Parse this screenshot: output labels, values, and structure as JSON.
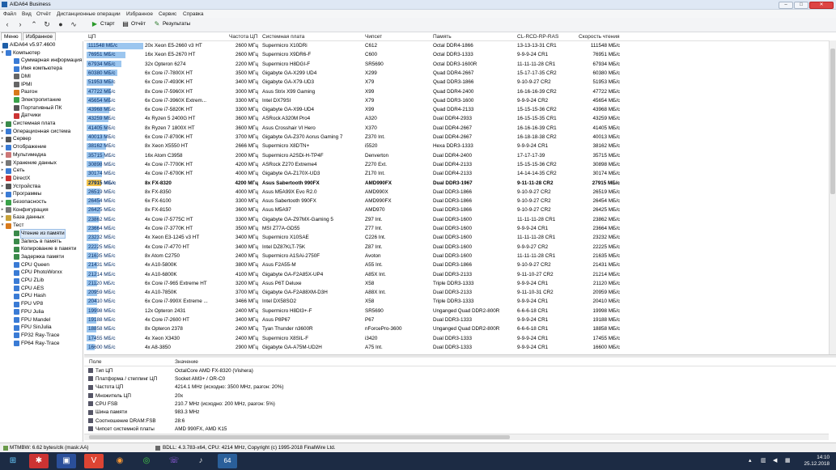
{
  "window": {
    "title": "AIDA64 Business"
  },
  "menu": [
    "Файл",
    "Вид",
    "Отчёт",
    "Дистанционные операции",
    "Избранное",
    "Сервис",
    "Справка"
  ],
  "toolbar": {
    "start": "Старт",
    "report": "Отчёт",
    "results": "Результаты"
  },
  "tabs": {
    "menu": "Меню",
    "favorites": "Избранное"
  },
  "tree": [
    {
      "label": "AIDA64 v5.97.4600",
      "level": 0,
      "exp": "",
      "color": "#1f5fa8"
    },
    {
      "label": "Компьютер",
      "level": 1,
      "exp": "▾",
      "color": "#3a7bd5"
    },
    {
      "label": "Суммарная информация",
      "level": 2,
      "exp": "",
      "color": "#3a7bd5"
    },
    {
      "label": "Имя компьютера",
      "level": 2,
      "exp": "",
      "color": "#3a7bd5"
    },
    {
      "label": "DMI",
      "level": 2,
      "exp": "",
      "color": "#666"
    },
    {
      "label": "IPMI",
      "level": 2,
      "exp": "",
      "color": "#666"
    },
    {
      "label": "Разгон",
      "level": 2,
      "exp": "",
      "color": "#d87a1c"
    },
    {
      "label": "Электропитание",
      "level": 2,
      "exp": "",
      "color": "#3aa24a"
    },
    {
      "label": "Портативный ПК",
      "level": 2,
      "exp": "",
      "color": "#555"
    },
    {
      "label": "Датчики",
      "level": 2,
      "exp": "",
      "color": "#c33"
    },
    {
      "label": "Системная плата",
      "level": 1,
      "exp": "▸",
      "color": "#3a8a4a"
    },
    {
      "label": "Операционная система",
      "level": 1,
      "exp": "▸",
      "color": "#3a7bd5"
    },
    {
      "label": "Сервер",
      "level": 1,
      "exp": "▸",
      "color": "#555"
    },
    {
      "label": "Отображение",
      "level": 1,
      "exp": "▸",
      "color": "#3a7bd5"
    },
    {
      "label": "Мультимедиа",
      "level": 1,
      "exp": "▸",
      "color": "#c77"
    },
    {
      "label": "Хранение данных",
      "level": 1,
      "exp": "▸",
      "color": "#777"
    },
    {
      "label": "Сеть",
      "level": 1,
      "exp": "▸",
      "color": "#3a7bd5"
    },
    {
      "label": "DirectX",
      "level": 1,
      "exp": "▸",
      "color": "#c33"
    },
    {
      "label": "Устройства",
      "level": 1,
      "exp": "▸",
      "color": "#555"
    },
    {
      "label": "Программы",
      "level": 1,
      "exp": "▸",
      "color": "#3a7bd5"
    },
    {
      "label": "Безопасность",
      "level": 1,
      "exp": "▸",
      "color": "#3aa24a"
    },
    {
      "label": "Конфигурация",
      "level": 1,
      "exp": "▸",
      "color": "#777"
    },
    {
      "label": "База данных",
      "level": 1,
      "exp": "▸",
      "color": "#c8a23a"
    },
    {
      "label": "Тест",
      "level": 1,
      "exp": "▾",
      "color": "#d87a1c"
    },
    {
      "label": "Чтение из памяти",
      "level": 2,
      "exp": "",
      "color": "#3a8a4a",
      "selected": true
    },
    {
      "label": "Запись в память",
      "level": 2,
      "exp": "",
      "color": "#3a8a4a"
    },
    {
      "label": "Копирование в памяти",
      "level": 2,
      "exp": "",
      "color": "#3a8a4a"
    },
    {
      "label": "Задержка памяти",
      "level": 2,
      "exp": "",
      "color": "#3a8a4a"
    },
    {
      "label": "CPU Queen",
      "level": 2,
      "exp": "",
      "color": "#3a7bd5"
    },
    {
      "label": "CPU PhotoWorxx",
      "level": 2,
      "exp": "",
      "color": "#3a7bd5"
    },
    {
      "label": "CPU ZLib",
      "level": 2,
      "exp": "",
      "color": "#3a7bd5"
    },
    {
      "label": "CPU AES",
      "level": 2,
      "exp": "",
      "color": "#3a7bd5"
    },
    {
      "label": "CPU Hash",
      "level": 2,
      "exp": "",
      "color": "#3a7bd5"
    },
    {
      "label": "FPU VP8",
      "level": 2,
      "exp": "",
      "color": "#3a7bd5"
    },
    {
      "label": "FPU Julia",
      "level": 2,
      "exp": "",
      "color": "#3a7bd5"
    },
    {
      "label": "FPU Mandel",
      "level": 2,
      "exp": "",
      "color": "#3a7bd5"
    },
    {
      "label": "FPU SinJulia",
      "level": 2,
      "exp": "",
      "color": "#3a7bd5"
    },
    {
      "label": "FP32 Ray-Trace",
      "level": 2,
      "exp": "",
      "color": "#3a7bd5"
    },
    {
      "label": "FP64 Ray-Trace",
      "level": 2,
      "exp": "",
      "color": "#3a7bd5"
    }
  ],
  "columns": [
    "ЦП",
    "Частота ЦП",
    "Системная плата",
    "Чипсет",
    "Память",
    "CL-RCD-RP-RAS",
    "Скорость чтения"
  ],
  "bar_max": 111548,
  "rows": [
    {
      "score": 111548,
      "speed": "111548 МБ/с",
      "cpu": "20x Xeon E5-2660 v3 HT",
      "freq": "2600 МГц",
      "board": "Supermicro X10DRi",
      "chipset": "C612",
      "mem": "Octal DDR4-1866",
      "timing": "13-13-13-31 CR1",
      "read": "111548 МБ/с"
    },
    {
      "score": 76951,
      "speed": "76951 МБ/с",
      "cpu": "16x Xeon E5-2670 HT",
      "freq": "2600 МГц",
      "board": "Supermicro X9DR6-F",
      "chipset": "C600",
      "mem": "Octal DDR3-1333",
      "timing": "9-9-9-24 CR1",
      "read": "76951 МБ/с"
    },
    {
      "score": 67934,
      "speed": "67934 МБ/с",
      "cpu": "32x Opteron 6274",
      "freq": "2200 МГц",
      "board": "Supermicro H8DGI-F",
      "chipset": "SR5690",
      "mem": "Octal DDR3-1600R",
      "timing": "11-11-11-28 CR1",
      "read": "67934 МБ/с"
    },
    {
      "score": 60380,
      "speed": "60380 МБ/с",
      "cpu": "6x Core i7-7800X HT",
      "freq": "3500 МГц",
      "board": "Gigabyte GA-X299 UD4",
      "chipset": "X299",
      "mem": "Quad DDR4-2667",
      "timing": "15-17-17-35 CR2",
      "read": "60380 МБ/с"
    },
    {
      "score": 51953,
      "speed": "51953 МБ/с",
      "cpu": "6x Core i7-4930K HT",
      "freq": "3400 МГц",
      "board": "Gigabyte GA-X79-UD3",
      "chipset": "X79",
      "mem": "Quad DDR3-1866",
      "timing": "9-10-9-27 CR2",
      "read": "51953 МБ/с"
    },
    {
      "score": 47722,
      "speed": "47722 МБ/с",
      "cpu": "8x Core i7-5960X HT",
      "freq": "3000 МГц",
      "board": "Asus Strix X99 Gaming",
      "chipset": "X99",
      "mem": "Quad DDR4-2400",
      "timing": "16-16-16-39 CR2",
      "read": "47722 МБ/с"
    },
    {
      "score": 45654,
      "speed": "45654 МБ/с",
      "cpu": "6x Core i7-3960X Extrem...",
      "freq": "3300 МГц",
      "board": "Intel DX79SI",
      "chipset": "X79",
      "mem": "Quad DDR3-1600",
      "timing": "9-9-9-24 CR2",
      "read": "45654 МБ/с"
    },
    {
      "score": 43968,
      "speed": "43968 МБ/с",
      "cpu": "6x Core i7-5820K HT",
      "freq": "3300 МГц",
      "board": "Gigabyte GA-X99-UD4",
      "chipset": "X99",
      "mem": "Quad DDR4-2133",
      "timing": "15-15-15-36 CR2",
      "read": "43968 МБ/с"
    },
    {
      "score": 43259,
      "speed": "43259 МБ/с",
      "cpu": "4x Ryzen 5 2400G HT",
      "freq": "3600 МГц",
      "board": "ASRock A320M Pro4",
      "chipset": "A320",
      "mem": "Dual DDR4-2933",
      "timing": "16-15-15-35 CR1",
      "read": "43259 МБ/с"
    },
    {
      "score": 41405,
      "speed": "41405 МБ/с",
      "cpu": "8x Ryzen 7 1800X HT",
      "freq": "3600 МГц",
      "board": "Asus Crosshair VI Hero",
      "chipset": "X370",
      "mem": "Dual DDR4-2667",
      "timing": "16-16-16-39 CR1",
      "read": "41405 МБ/с"
    },
    {
      "score": 40013,
      "speed": "40013 МБ/с",
      "cpu": "6x Core i7-8700K HT",
      "freq": "3700 МГц",
      "board": "Gigabyte GA-Z370 Aorus Gaming 7",
      "chipset": "Z370 Int.",
      "mem": "Dual DDR4-2667",
      "timing": "16-18-18-38 CR2",
      "read": "40013 МБ/с"
    },
    {
      "score": 38162,
      "speed": "38162 МБ/с",
      "cpu": "8x Xeon X5550 HT",
      "freq": "2666 МГц",
      "board": "Supermicro X8DTN+",
      "chipset": "i5520",
      "mem": "Hexa DDR3-1333",
      "timing": "9-9-9-24 CR1",
      "read": "38162 МБ/с"
    },
    {
      "score": 35715,
      "speed": "35715 МБ/с",
      "cpu": "16x Atom C3958",
      "freq": "2000 МГц",
      "board": "Supermicro A2SDi-H-TP4F",
      "chipset": "Denverton",
      "mem": "Dual DDR4-2400",
      "timing": "17-17-17-39",
      "read": "35715 МБ/с"
    },
    {
      "score": 30898,
      "speed": "30898 МБ/с",
      "cpu": "4x Core i7-7700K HT",
      "freq": "4200 МГц",
      "board": "ASRock Z270 Extreme4",
      "chipset": "Z270 Ext.",
      "mem": "Dual DDR4-2133",
      "timing": "15-15-15-36 CR2",
      "read": "30898 МБ/с"
    },
    {
      "score": 30174,
      "speed": "30174 МБ/с",
      "cpu": "4x Core i7-6700K HT",
      "freq": "4000 МГц",
      "board": "Gigabyte GA-Z170X-UD3",
      "chipset": "Z170 Int.",
      "mem": "Dual DDR4-2133",
      "timing": "14-14-14-35 CR2",
      "read": "30174 МБ/с"
    },
    {
      "score": 27915,
      "speed": "27915 МБ/с",
      "cpu": "8x FX-8320",
      "freq": "4200 МГц",
      "board": "Asus Sabertooth 990FX",
      "chipset": "AMD990FX",
      "mem": "Dual DDR3-1967",
      "timing": "9-11-11-28 CR2",
      "read": "27915 МБ/с",
      "bold": true
    },
    {
      "score": 26519,
      "speed": "26519 МБ/с",
      "cpu": "8x FX-8350",
      "freq": "4000 МГц",
      "board": "Asus M5A99X Evo R2.0",
      "chipset": "AMD990X",
      "mem": "Dual DDR3-1866",
      "timing": "9-10-9-27 CR2",
      "read": "26519 МБ/с"
    },
    {
      "score": 26454,
      "speed": "26454 МБ/с",
      "cpu": "6x FX-6100",
      "freq": "3300 МГц",
      "board": "Asus Sabertooth 990FX",
      "chipset": "AMD990FX",
      "mem": "Dual DDR3-1866",
      "timing": "9-10-9-27 CR2",
      "read": "26454 МБ/с"
    },
    {
      "score": 26425,
      "speed": "26425 МБ/с",
      "cpu": "8x FX-8150",
      "freq": "3600 МГц",
      "board": "Asus M5A97",
      "chipset": "AMD970",
      "mem": "Dual DDR3-1866",
      "timing": "9-10-9-27 CR2",
      "read": "26425 МБ/с"
    },
    {
      "score": 23862,
      "speed": "23862 МБ/с",
      "cpu": "4x Core i7-5775C HT",
      "freq": "3300 МГц",
      "board": "Gigabyte GA-Z97MX-Gaming 5",
      "chipset": "Z97 Int.",
      "mem": "Dual DDR3-1600",
      "timing": "11-11-11-28 CR1",
      "read": "23862 МБ/с"
    },
    {
      "score": 23664,
      "speed": "23664 МБ/с",
      "cpu": "4x Core i7-3770K HT",
      "freq": "3500 МГц",
      "board": "MSI Z77A-GD55",
      "chipset": "Z77 Int.",
      "mem": "Dual DDR3-1600",
      "timing": "9-9-9-24 CR1",
      "read": "23664 МБ/с"
    },
    {
      "score": 23232,
      "speed": "23232 МБ/с",
      "cpu": "4x Xeon E3-1245 v3 HT",
      "freq": "3400 МГц",
      "board": "Supermicro X10SAE",
      "chipset": "C226 Int.",
      "mem": "Dual DDR3-1600",
      "timing": "11-11-11-28 CR1",
      "read": "23232 МБ/с"
    },
    {
      "score": 22225,
      "speed": "22225 МБ/с",
      "cpu": "4x Core i7-4770 HT",
      "freq": "3400 МГц",
      "board": "Intel DZ87KLT-75K",
      "chipset": "Z87 Int.",
      "mem": "Dual DDR3-1600",
      "timing": "9-9-9-27 CR2",
      "read": "22225 МБ/с"
    },
    {
      "score": 21635,
      "speed": "21635 МБ/с",
      "cpu": "8x Atom C2750",
      "freq": "2400 МГц",
      "board": "Supermicro A1SAi-2750F",
      "chipset": "Avoton",
      "mem": "Dual DDR3-1600",
      "timing": "11-11-11-28 CR1",
      "read": "21635 МБ/с"
    },
    {
      "score": 21431,
      "speed": "21431 МБ/с",
      "cpu": "4x A10-5800K",
      "freq": "3800 МГц",
      "board": "Asus F2A55-M",
      "chipset": "A55 Int.",
      "mem": "Dual DDR3-1866",
      "timing": "9-10-9-27 CR2",
      "read": "21431 МБ/с"
    },
    {
      "score": 21214,
      "speed": "21214 МБ/с",
      "cpu": "4x A10-6800K",
      "freq": "4100 МГц",
      "board": "Gigabyte GA-F2A85X-UP4",
      "chipset": "A85X Int.",
      "mem": "Dual DDR3-2133",
      "timing": "9-11-10-27 CR2",
      "read": "21214 МБ/с"
    },
    {
      "score": 21120,
      "speed": "21120 МБ/с",
      "cpu": "6x Core i7-965 Extreme HT",
      "freq": "3200 МГц",
      "board": "Asus P6T Deluxe",
      "chipset": "X58",
      "mem": "Triple DDR3-1333",
      "timing": "9-9-9-24 CR1",
      "read": "21120 МБ/с"
    },
    {
      "score": 20959,
      "speed": "20959 МБ/с",
      "cpu": "4x A10-7850K",
      "freq": "3700 МГц",
      "board": "Gigabyte GA-F2A88XM-D3H",
      "chipset": "A88X Int.",
      "mem": "Dual DDR3-2133",
      "timing": "9-11-10-31 CR2",
      "read": "20959 МБ/с"
    },
    {
      "score": 20410,
      "speed": "20410 МБ/с",
      "cpu": "6x Core i7-990X Extreme ...",
      "freq": "3466 МГц",
      "board": "Intel DX58SO2",
      "chipset": "X58",
      "mem": "Triple DDR3-1333",
      "timing": "9-9-9-24 CR1",
      "read": "20410 МБ/с"
    },
    {
      "score": 19998,
      "speed": "19998 МБ/с",
      "cpu": "12x Opteron 2431",
      "freq": "2400 МГц",
      "board": "Supermicro H8DI3+-F",
      "chipset": "SR5690",
      "mem": "Unganged Quad DDR2-800R",
      "timing": "6-6-6-18 CR1",
      "read": "19998 МБ/с"
    },
    {
      "score": 19188,
      "speed": "19188 МБ/с",
      "cpu": "4x Core i7-2600 HT",
      "freq": "3400 МГц",
      "board": "Asus P8P67",
      "chipset": "P67",
      "mem": "Dual DDR3-1333",
      "timing": "9-9-9-24 CR1",
      "read": "19188 МБ/с"
    },
    {
      "score": 18858,
      "speed": "18858 МБ/с",
      "cpu": "8x Opteron 2378",
      "freq": "2400 МГц",
      "board": "Tyan Thunder n3600R",
      "chipset": "nForcePro-3600",
      "mem": "Unganged Quad DDR2-800R",
      "timing": "6-6-6-18 CR1",
      "read": "18858 МБ/с"
    },
    {
      "score": 17455,
      "speed": "17455 МБ/с",
      "cpu": "4x Xeon X3430",
      "freq": "2400 МГц",
      "board": "Supermicro X8SIL-F",
      "chipset": "i3420",
      "mem": "Dual DDR3-1333",
      "timing": "9-9-9-24 CR1",
      "read": "17455 МБ/с"
    },
    {
      "score": 16600,
      "speed": "16600 МБ/с",
      "cpu": "4x A8-3850",
      "freq": "2900 МГц",
      "board": "Gigabyte GA-A75M-UD2H",
      "chipset": "A75 Int.",
      "mem": "Dual DDR3-1333",
      "timing": "9-9-9-24 CR1",
      "read": "16600 МБ/с"
    }
  ],
  "details_columns": [
    "Поле",
    "Значение"
  ],
  "details": [
    {
      "field": "Тип ЦП",
      "value": "OctalCore AMD FX-8320  (Vishera)"
    },
    {
      "field": "Платформа / степпинг ЦП",
      "value": "Socket AM3+ / OR-C0"
    },
    {
      "field": "Частота ЦП",
      "value": "4214.1 MHz  (исходно: 3500 MHz, разгон: 20%)"
    },
    {
      "field": "Множитель ЦП",
      "value": "20x"
    },
    {
      "field": "CPU FSB",
      "value": "210.7 MHz  (исходно: 200 MHz, разгон: 5%)"
    },
    {
      "field": "Шина памяти",
      "value": "983.3 MHz"
    },
    {
      "field": "Соотношение DRAM:FSB",
      "value": "28:6"
    },
    {
      "field": "Чипсет системной платы",
      "value": "AMD 990FX, AMD K15"
    }
  ],
  "status": {
    "left": "MTMBW: 6.62 bytes/clk (mask:AA)",
    "right": "BDLL: 4.3.783-x64, CPU: 4214 MHz, Copyright (c) 1995-2018 FinalWire Ltd."
  },
  "clock": {
    "time": "14:10",
    "date": "25.12.2018"
  }
}
